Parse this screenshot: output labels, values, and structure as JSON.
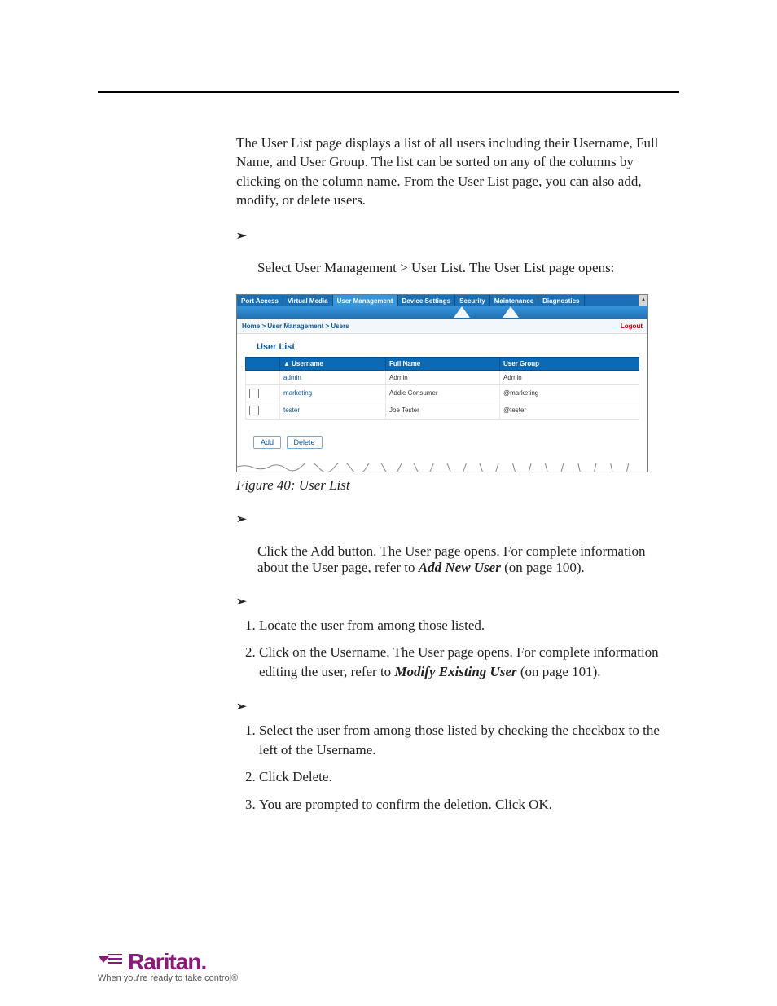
{
  "intro": "The User List page displays a list of all users including their Username, Full Name, and User Group. The list can be sorted on any of the columns by clicking on the column name. From the User List page, you can also add, modify, or delete users.",
  "step_open": "Select User Management > User List. The User List page opens:",
  "caption": "Figure 40: User List",
  "shot": {
    "tabs": [
      "Port Access",
      "Virtual Media",
      "User Management",
      "Device Settings",
      "Security",
      "Maintenance",
      "Diagnostics"
    ],
    "selected_tab_index": 2,
    "breadcrumb": "Home > User Management > Users",
    "logout": "Logout",
    "panel_title": "User List",
    "headers": {
      "c1": "",
      "c2": "▲ Username",
      "c3": "Full Name",
      "c4": "User Group"
    },
    "rows": [
      {
        "checkbox": null,
        "username": "admin",
        "fullname": "Admin",
        "group": "Admin"
      },
      {
        "checkbox": false,
        "username": "marketing",
        "fullname": "Addie Consumer",
        "group": "@marketing"
      },
      {
        "checkbox": false,
        "username": "tester",
        "fullname": "Joe Tester",
        "group": "@tester"
      }
    ],
    "buttons": {
      "add": "Add",
      "delete": "Delete"
    }
  },
  "add_text_1": "Click the Add button. The User page opens. For complete information about the User page, refer to ",
  "add_ref": "Add New User",
  "add_text_2": " (on page 100).",
  "modify_steps": {
    "s1": "Locate the user from among those listed.",
    "s2a": "Click on the Username. The User page opens. For complete information editing the user, refer to ",
    "s2ref": "Modify Existing User",
    "s2b": " (on page 101)."
  },
  "delete_steps": {
    "s1": "Select the user from among those listed by checking the checkbox to the left of the Username.",
    "s2": "Click Delete.",
    "s3": "You are prompted to confirm the deletion. Click OK."
  },
  "logo": {
    "brand": "Raritan.",
    "tagline": "When you're ready to take control®"
  }
}
